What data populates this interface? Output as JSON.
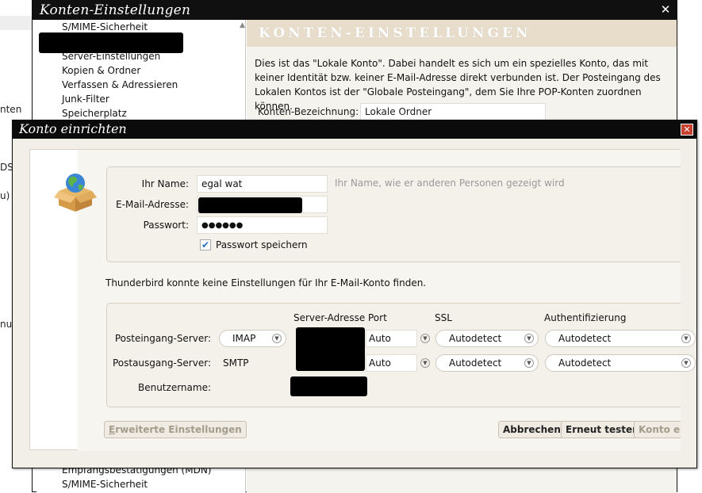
{
  "background_fragments": {
    "f1": "nten",
    "f2": "DSL",
    "f3": "u)",
    "f4": "nur"
  },
  "accounts_window": {
    "title": "Konten-Einstellungen",
    "close_glyph": "✕",
    "tree_items_top": [
      "S/MIME-Sicherheit",
      "Server-Einstellungen",
      "Kopien & Ordner",
      "Verfassen & Adressieren",
      "Junk-Filter",
      "Speicherplatz"
    ],
    "tree_items_bottom": [
      "Empfangsbestätigungen (MDN)",
      "S/MIME-Sicherheit"
    ],
    "panel_heading": "KONTEN-EINSTELLUNGEN",
    "description": "Dies ist das \"Lokale Konto\". Dabei handelt es sich um ein spezielles Konto, das mit keiner Identität bzw. keiner E-Mail-Adresse direkt verbunden ist. Der Posteingang des Lokalen Kontos ist der \"Globale Posteingang\", dem Sie Ihre POP-Konten zuordnen können.",
    "account_name_label": "Konten-Bezeichnung:",
    "account_name_value": "Lokale Ordner"
  },
  "setup_dialog": {
    "title": "Konto einrichten",
    "close_glyph": "✕",
    "icon": "globe-box-icon",
    "name_label": "Ihr Name:",
    "name_value": "egal wat",
    "name_hint": "Ihr Name, wie er anderen Personen gezeigt wird",
    "email_label": "E-Mail-Adresse:",
    "password_label": "Passwort:",
    "password_value": "●●●●●●",
    "remember_password_label": "Passwort speichern",
    "remember_password_checked": true,
    "info_text": "Thunderbird konnte keine Einstellungen für Ihr E-Mail-Konto finden.",
    "columns": {
      "server_address": "Server-Adresse",
      "port": "Port",
      "ssl": "SSL",
      "auth": "Authentifizierung"
    },
    "incoming": {
      "label": "Posteingang-Server:",
      "protocol": "IMAP",
      "port": "Auto",
      "ssl": "Autodetect",
      "auth": "Autodetect"
    },
    "outgoing": {
      "label": "Postausgang-Server:",
      "protocol": "SMTP",
      "port": "Auto",
      "ssl": "Autodetect",
      "auth": "Autodetect"
    },
    "username_label": "Benutzername:",
    "buttons": {
      "advanced": "Erweiterte Einstellungen",
      "cancel": "Abbrechen",
      "retest": "Erneut testen",
      "create": "Konto erstell"
    }
  }
}
